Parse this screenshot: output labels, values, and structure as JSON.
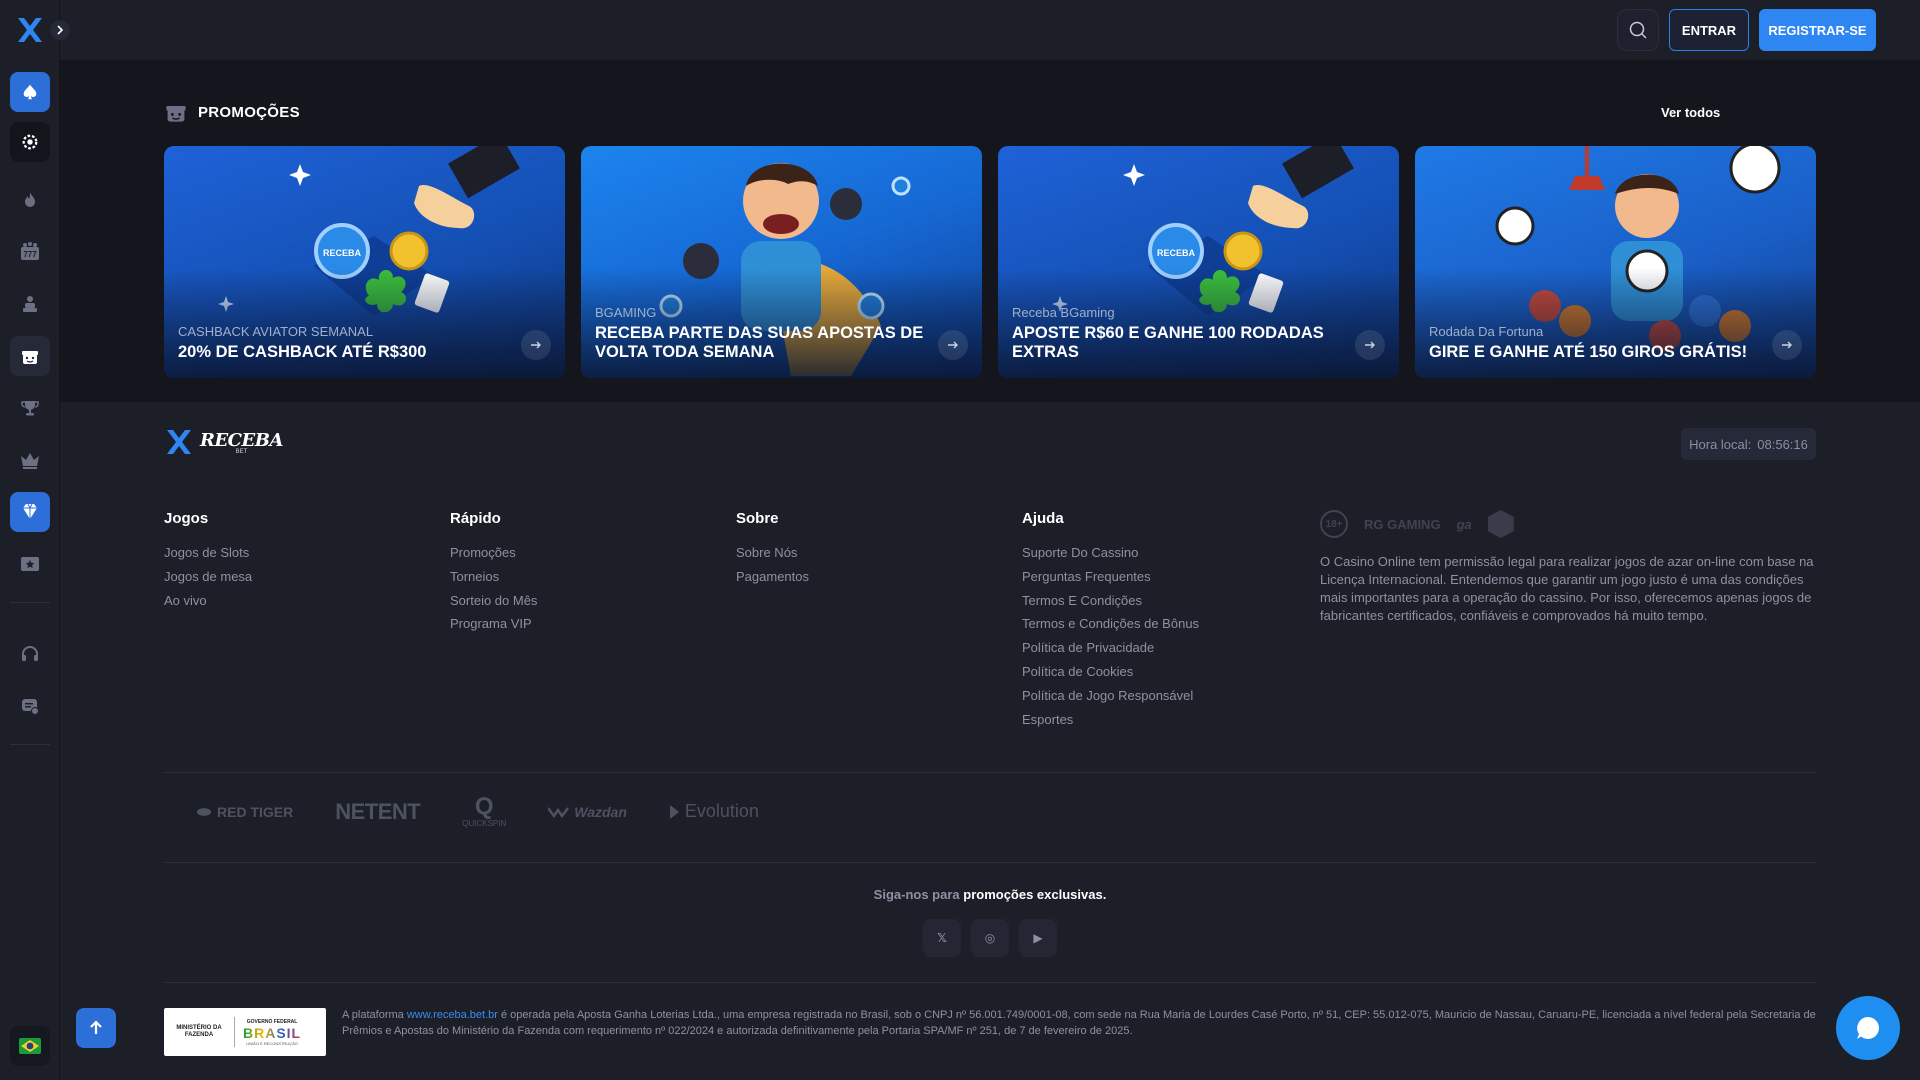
{
  "header": {
    "login_label": "ENTRAR",
    "register_label": "REGISTRAR-SE"
  },
  "sidebar": {
    "items": [
      {
        "icon": "spade-icon"
      },
      {
        "icon": "casino-chip-icon"
      },
      {
        "icon": "fire-icon"
      },
      {
        "icon": "slots-777-icon"
      },
      {
        "icon": "dealer-icon"
      },
      {
        "icon": "gift-icon"
      },
      {
        "icon": "trophy-icon"
      },
      {
        "icon": "crown-icon"
      },
      {
        "icon": "vip-diamond-icon"
      },
      {
        "icon": "ticket-star-icon"
      },
      {
        "icon": "headset-icon"
      },
      {
        "icon": "chat-settings-icon"
      },
      {
        "icon": "brazil-flag-icon"
      }
    ]
  },
  "promotions": {
    "title": "PROMOÇÕES",
    "see_all": "Ver todos",
    "cards": [
      {
        "subtitle": "CASHBACK AVIATOR SEMANAL",
        "title": "20% DE CASHBACK ATÉ R$300"
      },
      {
        "subtitle": "BGAMING",
        "title": "RECEBA PARTE DAS SUAS APOSTAS DE VOLTA TODA SEMANA"
      },
      {
        "subtitle": "Receba BGaming",
        "title": "APOSTE R$60 E GANHE 100 RODADAS EXTRAS"
      },
      {
        "subtitle": "Rodada Da Fortuna",
        "title": "GIRE E GANHE ATÉ 150 GIROS GRÁTIS!"
      }
    ]
  },
  "footer": {
    "logo_text": "RECEBA",
    "logo_sub": "BET",
    "clock_label": "Hora local:",
    "clock_value": "08:56:16",
    "columns": [
      {
        "title": "Jogos",
        "links": [
          "Jogos de Slots",
          "Jogos de mesa",
          "Ao vivo"
        ]
      },
      {
        "title": "Rápido",
        "links": [
          "Promoções",
          "Torneios",
          "Sorteio do Mês",
          "Programa VIP"
        ]
      },
      {
        "title": "Sobre",
        "links": [
          "Sobre Nós",
          "Pagamentos"
        ]
      },
      {
        "title": "Ajuda",
        "links": [
          "Suporte Do Cassino",
          "Perguntas Frequentes",
          "Termos E Condições",
          "Termos e Condições de Bônus",
          "Política de Privacidade",
          "Política de Cookies",
          "Política de Jogo Responsável",
          "Esportes"
        ]
      }
    ],
    "badges": {
      "age": "18+",
      "gaming": "RG GAMING",
      "ga": "ga"
    },
    "legal_text": "O Casino Online tem permissão legal para realizar jogos de azar on-line com base na Licença Internacional. Entendemos que garantir um jogo justo é uma das condições mais importantes para a operação do cassino. Por isso, oferecemos apenas jogos de fabricantes certificados, confiáveis e comprovados há muito tempo.",
    "providers": [
      "RED TIGER",
      "NETENT",
      "QUICKSPIN",
      "Wazdan",
      "Evolution"
    ],
    "follow_dim": "Siga-nos para",
    "follow_strong": "promoções exclusivas.",
    "socials": [
      "𝕏",
      "◎",
      "▶"
    ],
    "gov": {
      "ministry": "MINISTÉRIO DA FAZENDA",
      "gov_top": "GOVERNO FEDERAL",
      "gov_main": "BRASIL",
      "gov_bottom": "UNIÃO E RECONSTRUÇÃO"
    },
    "bottom_legal_pre": "A plataforma ",
    "bottom_legal_link": "www.receba.bet.br",
    "bottom_legal_post": " é operada pela Aposta Ganha Loterias Ltda., uma empresa registrada no Brasil, sob o CNPJ nº 56.001.749/0001-08, com sede na Rua Maria de Lourdes Casé Porto, nº 51, CEP: 55.012-075, Mauricio de Nassau, Caruaru-PE, licenciada a nível federal pela Secretaria de Prêmios e Apostas do Ministério da Fazenda com requerimento nº 022/2024 e autorizada definitivamente pela Portaria SPA/MF nº 251, de 7 de fevereiro de 2025."
  },
  "colors": {
    "accent": "#2d86f2",
    "background": "#1c1e28",
    "promo_band": "#15161d",
    "link": "#3d8cf0"
  }
}
